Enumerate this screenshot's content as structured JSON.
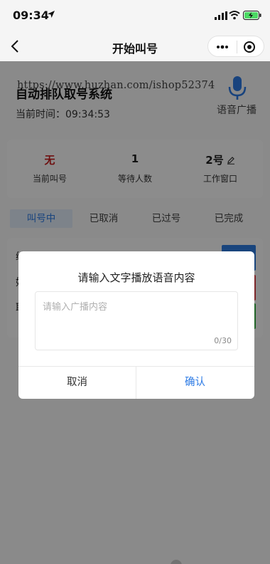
{
  "status_bar": {
    "time": "09:34"
  },
  "nav": {
    "title": "开始叫号"
  },
  "header": {
    "system_title": "自动排队取号系统",
    "watermark": "https://www.huzhan.com/ishop52374",
    "current_time_label": "当前时间：",
    "current_time_value": "09:34:53",
    "voice_label": "语音广播"
  },
  "stats": [
    {
      "value": "无",
      "label": "当前叫号"
    },
    {
      "value": "1",
      "label": "等待人数"
    },
    {
      "value": "2号",
      "label": "工作窗口"
    }
  ],
  "tabs": [
    {
      "label": "叫号中",
      "active": true
    },
    {
      "label": "已取消"
    },
    {
      "label": "已过号"
    },
    {
      "label": "已完成"
    }
  ],
  "list_rows": [
    "编",
    "姓",
    "取"
  ],
  "dialog": {
    "title": "请输入文字播放语音内容",
    "placeholder": "请输入广播内容",
    "value": "",
    "counter": "0/30",
    "cancel_label": "取消",
    "confirm_label": "确认"
  },
  "colors": {
    "accent": "#2d7be5",
    "highlight_red": "#c81e1e",
    "btn_blue": "#2f7fe3",
    "btn_red": "#e5484d",
    "btn_green": "#3cb84a"
  }
}
